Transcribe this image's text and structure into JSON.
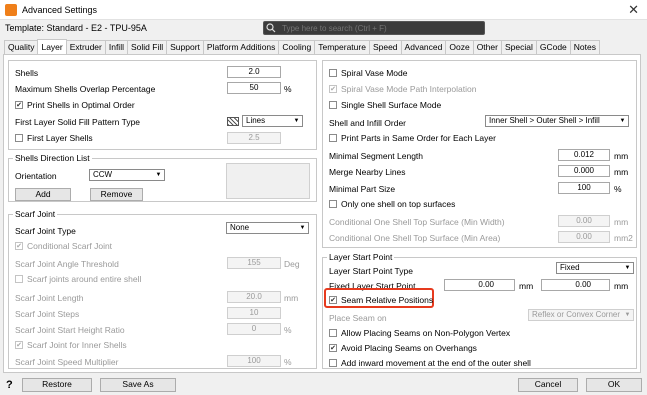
{
  "window": {
    "title": "Advanced Settings",
    "close_glyph": "✕"
  },
  "template_label": "Template: Standard - E2 - TPU-95A",
  "search": {
    "placeholder": "Type here to search (Ctrl + F)"
  },
  "tabs": [
    "Quality",
    "Layer",
    "Extruder",
    "Infill",
    "Solid Fill",
    "Support",
    "Platform Additions",
    "Cooling",
    "Temperature",
    "Speed",
    "Advanced",
    "Ooze",
    "Other",
    "Special",
    "GCode",
    "Notes"
  ],
  "active_tab": "Layer",
  "left": {
    "shells": {
      "label": "Shells",
      "value": "2.0"
    },
    "overlap": {
      "label": "Maximum Shells Overlap Percentage",
      "value": "50",
      "unit": "%"
    },
    "print_shells_optimal": {
      "label": "Print Shells in Optimal Order",
      "checked": true
    },
    "first_layer_pattern": {
      "label": "First Layer Solid Fill Pattern Type",
      "value": "Lines"
    },
    "first_layer_shells": {
      "label": "First Layer Shells",
      "value": "2.5",
      "checked": false
    },
    "shells_dir": {
      "title": "Shells Direction List",
      "orientation_label": "Orientation",
      "orientation_value": "CCW",
      "add": "Add",
      "remove": "Remove"
    },
    "scarf": {
      "title": "Scarf Joint",
      "type_label": "Scarf Joint Type",
      "type_value": "None",
      "conditional": "Conditional Scarf Joint",
      "angle_label": "Scarf Joint Angle Threshold",
      "angle_value": "155",
      "angle_unit": "Deg",
      "around_shell": "Scarf joints around entire shell",
      "length_label": "Scarf Joint Length",
      "length_value": "20.0",
      "length_unit": "mm",
      "steps_label": "Scarf Joint Steps",
      "steps_value": "10",
      "start_height_label": "Scarf Joint Start Height Ratio",
      "start_height_value": "0",
      "start_height_unit": "%",
      "inner_shells": "Scarf Joint for Inner Shells",
      "speed_mult_label": "Scarf Joint Speed Multiplier",
      "speed_mult_value": "100",
      "speed_mult_unit": "%"
    }
  },
  "right": {
    "spiral_vase": "Spiral Vase Mode",
    "spiral_interp": "Spiral Vase Mode Path Interpolation",
    "single_shell": "Single Shell Surface Mode",
    "order_label": "Shell and Infill Order",
    "order_value": "Inner Shell > Outer Shell > Infill",
    "same_order": "Print Parts in Same Order for Each Layer",
    "min_seg_label": "Minimal Segment Length",
    "min_seg_value": "0.012",
    "min_seg_unit": "mm",
    "merge_label": "Merge Nearby Lines",
    "merge_value": "0.000",
    "merge_unit": "mm",
    "min_part_label": "Minimal Part Size",
    "min_part_value": "100",
    "min_part_unit": "%",
    "one_shell_top": "Only one shell on top surfaces",
    "cond_min_width_label": "Conditional One Shell Top Surface (Min Width)",
    "cond_min_width_value": "0.00",
    "cond_min_width_unit": "mm",
    "cond_min_area_label": "Conditional One Shell Top Surface (Min Area)",
    "cond_min_area_value": "0.00",
    "cond_min_area_unit": "mm2",
    "layer_start": {
      "title": "Layer Start Point",
      "type_label": "Layer Start Point Type",
      "type_value": "Fixed",
      "fixed_label": "Fixed Layer Start Point",
      "fixed_x": "0.00",
      "fixed_y": "0.00",
      "unit": "mm",
      "seam_relative": "Seam Relative Positions",
      "place_seam_label": "Place Seam on",
      "place_seam_value": "Reflex or Convex Corner",
      "non_polygon": "Allow Placing Seams on Non-Polygon Vertex",
      "avoid_overhangs": "Avoid Placing Seams on Overhangs",
      "inward": "Add inward movement at the end of the outer shell"
    }
  },
  "footer": {
    "help": "?",
    "restore": "Restore",
    "save_as": "Save As",
    "cancel": "Cancel",
    "ok": "OK"
  },
  "colors": {
    "highlight": "#e63a1e",
    "dark_search": "#3b3b3b",
    "disabled_text": "#9a9a9a"
  }
}
